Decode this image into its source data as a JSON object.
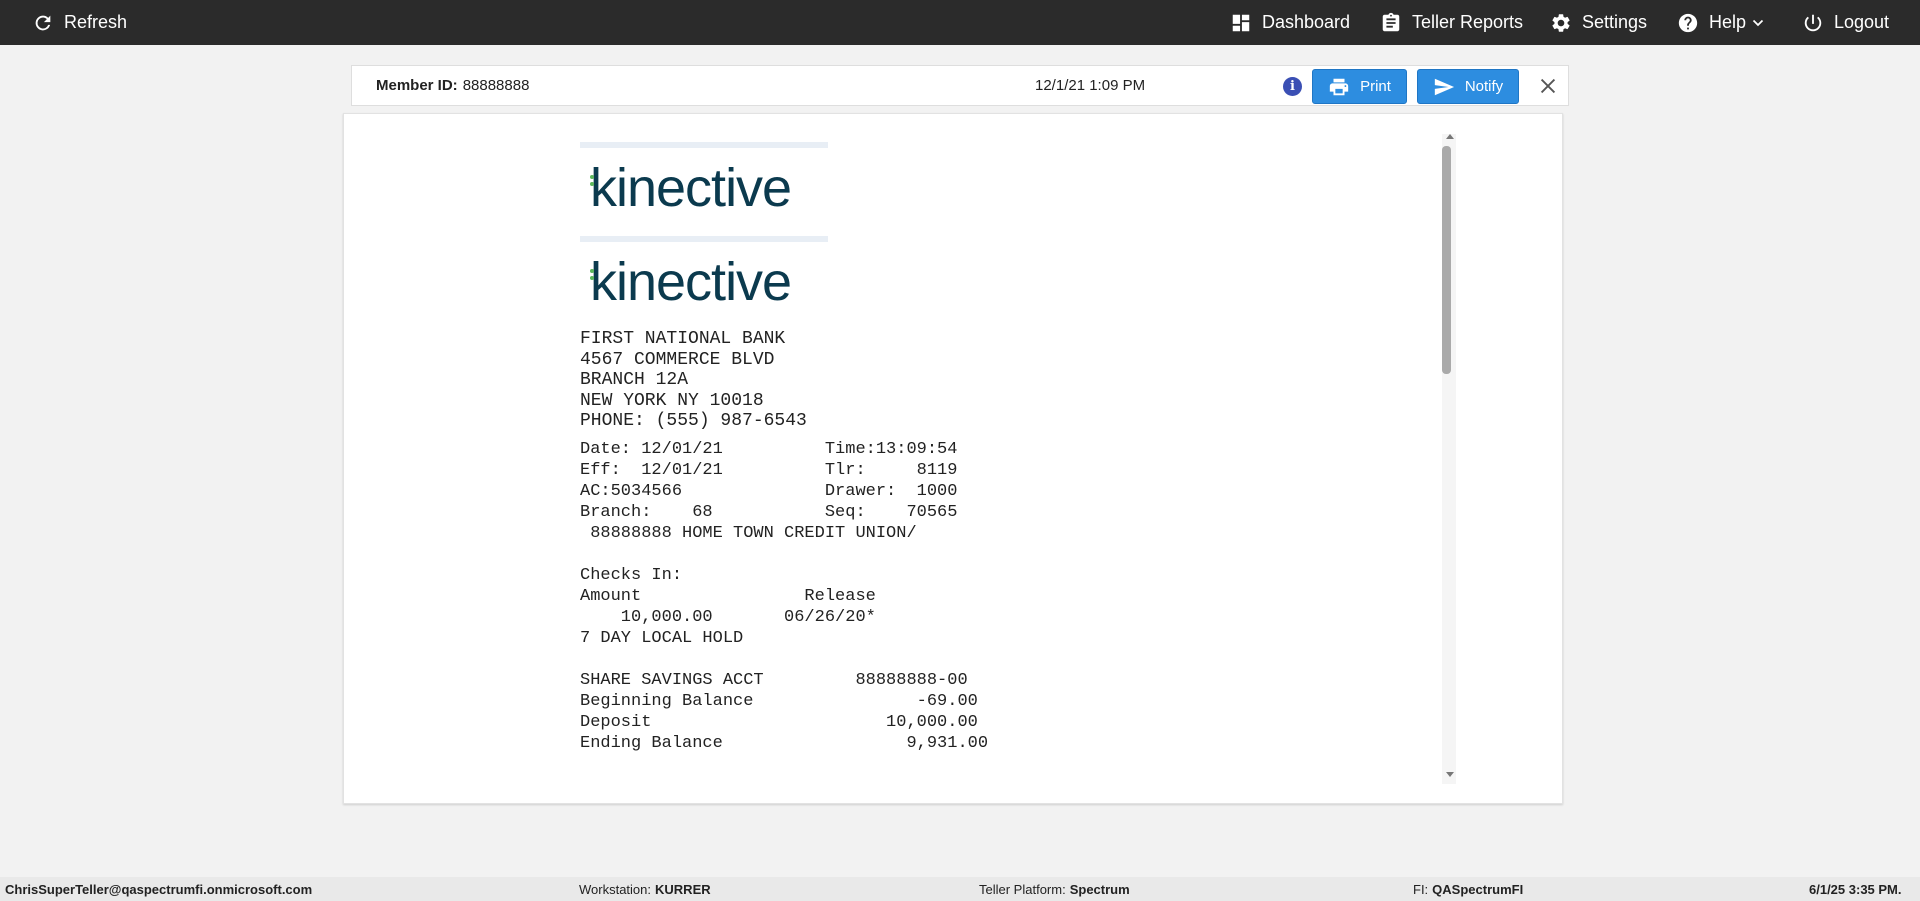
{
  "topbar": {
    "refresh": "Refresh",
    "dashboard": "Dashboard",
    "teller_reports": "Teller Reports",
    "settings": "Settings",
    "help": "Help",
    "logout": "Logout"
  },
  "header": {
    "member_label": "Member ID:",
    "member_id": "88888888",
    "datetime": "12/1/21 1:09 PM",
    "info_glyph": "i",
    "print": "Print",
    "notify": "Notify"
  },
  "receipt": {
    "logo_text": "kinective",
    "address_lines": [
      "FIRST NATIONAL BANK",
      "4567 COMMERCE BLVD",
      "BRANCH 12A",
      "NEW YORK NY 10018",
      "PHONE: (555) 987-6543"
    ],
    "detail_lines": [
      "Date: 12/01/21          Time:13:09:54",
      "Eff:  12/01/21          Tlr:     8119",
      "AC:5034566              Drawer:  1000",
      "Branch:    68           Seq:    70565",
      " 88888888 HOME TOWN CREDIT UNION/"
    ],
    "checks_lines": [
      "Checks In:",
      "Amount                Release",
      "    10,000.00       06/26/20*",
      "7 DAY LOCAL HOLD"
    ],
    "savings_lines": [
      "SHARE SAVINGS ACCT         88888888-00",
      "Beginning Balance                -69.00",
      "Deposit                       10,000.00",
      "Ending Balance                  9,931.00"
    ]
  },
  "footer": {
    "user": "ChrisSuperTeller@qaspectrumfi.onmicrosoft.com",
    "workstation_label": "Workstation:",
    "workstation": "KURRER",
    "platform_label": "Teller Platform:",
    "platform": "Spectrum",
    "fi_label": "FI:",
    "fi": "QASpectrumFI",
    "datetime": "6/1/25 3:35 PM."
  }
}
